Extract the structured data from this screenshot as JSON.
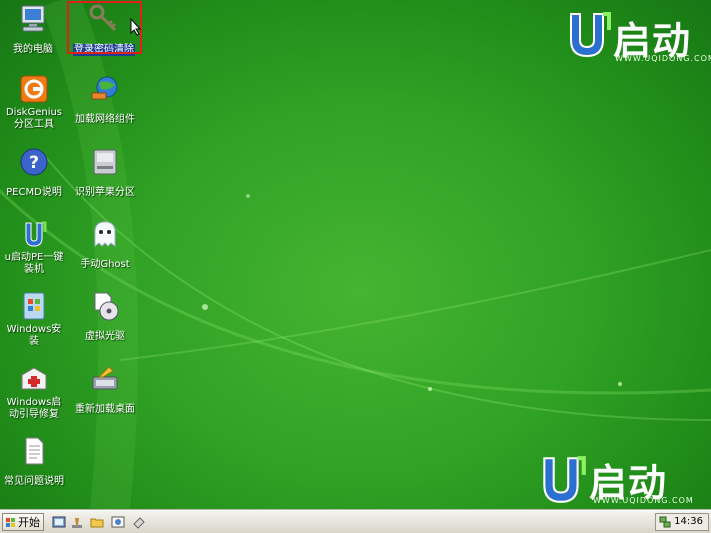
{
  "desktop": {
    "icons": [
      {
        "label": "我的电脑",
        "icon": "my-computer-icon"
      },
      {
        "label": "登录密码清除",
        "icon": "key-icon",
        "selected": true
      },
      {
        "label": "DiskGenius分区工具",
        "icon": "diskgenius-icon"
      },
      {
        "label": "加载网络组件",
        "icon": "network-globe-icon"
      },
      {
        "label": "PECMD说明",
        "icon": "help-icon"
      },
      {
        "label": "识别苹果分区",
        "icon": "drive-icon"
      },
      {
        "label": "u启动PE一键装机",
        "icon": "u-logo-icon"
      },
      {
        "label": "手动Ghost",
        "icon": "ghost-icon"
      },
      {
        "label": "Windows安装",
        "icon": "windows-install-icon"
      },
      {
        "label": "虚拟光驱",
        "icon": "virtual-cd-icon"
      },
      {
        "label": "Windows启动引导修复",
        "icon": "repair-kit-icon"
      },
      {
        "label": "重新加载桌面",
        "icon": "reload-desktop-icon"
      },
      {
        "label": "常见问题说明",
        "icon": "document-icon"
      }
    ]
  },
  "logo": {
    "brand": "启动",
    "url": "WWW.UQIDONG.COM"
  },
  "taskbar": {
    "start_label": "开始",
    "quick_launch": [
      "pe-tools-icon",
      "stamp-icon",
      "folder-icon",
      "photo-icon",
      "eraser-icon"
    ],
    "clock": "14:36",
    "tray_icon": "network-tray-icon"
  },
  "colors": {
    "desktop_green": "#2fa124",
    "selection_box": "#e0201b",
    "selected_label_bg": "#1c3f96"
  }
}
